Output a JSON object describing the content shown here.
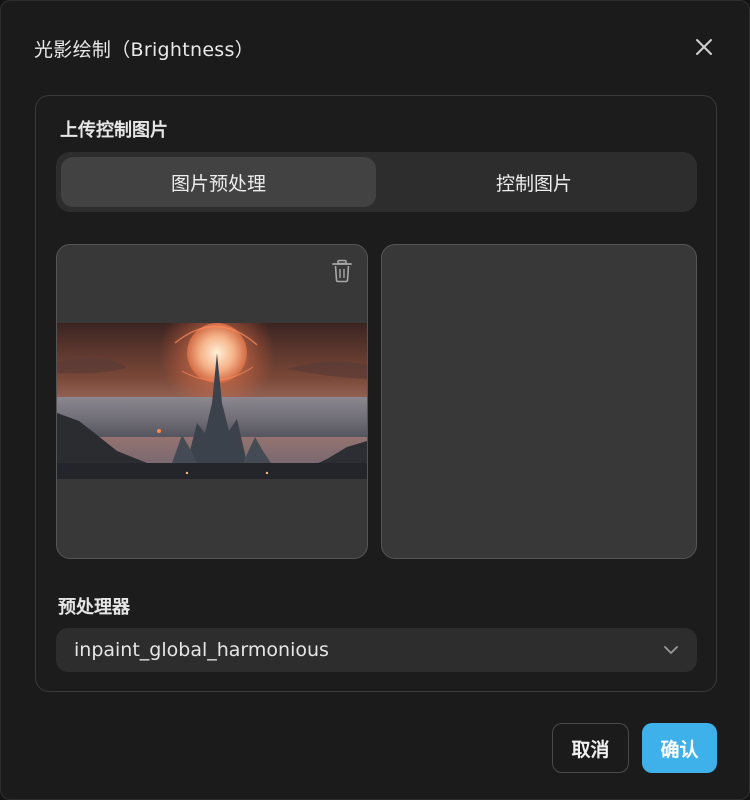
{
  "dialog": {
    "title": "光影绘制（Brightness）",
    "close_icon": "close-icon"
  },
  "upload": {
    "section_label": "上传控制图片",
    "tabs": [
      {
        "label": "图片预处理",
        "active": true
      },
      {
        "label": "控制图片",
        "active": false
      }
    ],
    "delete_icon": "trash-icon"
  },
  "preprocessor": {
    "section_label": "预处理器",
    "selected": "inpaint_global_harmonious",
    "chevron_icon": "chevron-down-icon"
  },
  "footer": {
    "cancel_label": "取消",
    "confirm_label": "确认"
  },
  "colors": {
    "accent": "#3fb1ea",
    "background": "#1b1b1b",
    "card": "#383838"
  }
}
